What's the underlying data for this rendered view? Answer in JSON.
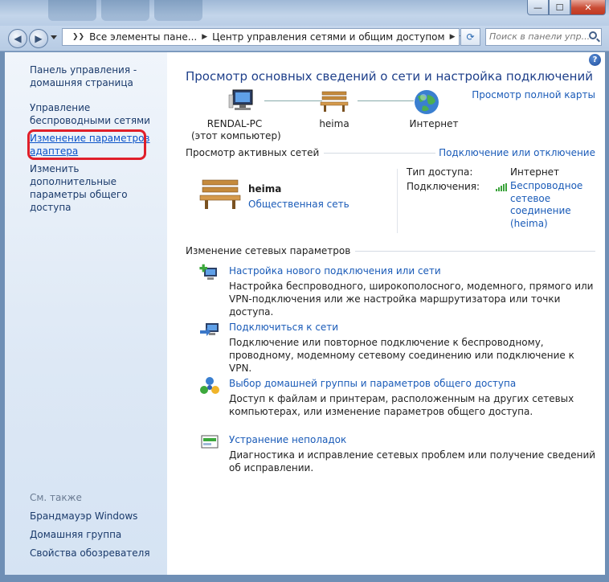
{
  "window": {
    "minimize_glyph": "—",
    "maximize_glyph": "☐",
    "close_glyph": "✕"
  },
  "address": {
    "crumbs": [
      "Все элементы пане...",
      "Центр управления сетями и общим доступом"
    ],
    "search_placeholder": "Поиск в панели упр..."
  },
  "sidebar": {
    "home": "Панель управления - домашняя страница",
    "wireless": "Управление беспроводными сетями",
    "adapter": "Изменение параметров адаптера",
    "advanced": "Изменить дополнительные параметры общего доступа",
    "see_also_title": "См. также",
    "see_also": [
      "Брандмауэр Windows",
      "Домашняя группа",
      "Свойства обозревателя"
    ]
  },
  "main": {
    "help": "?",
    "title": "Просмотр основных сведений о сети и настройка подключений",
    "full_map": "Просмотр полной карты",
    "map": {
      "computer_name": "RENDAL-PC",
      "computer_sub": "(этот компьютер)",
      "network": "heima",
      "internet": "Интернет"
    },
    "active_header": "Просмотр активных сетей",
    "connect_disconnect": "Подключение или отключение",
    "active": {
      "name": "heima",
      "type": "Общественная сеть",
      "access_label": "Тип доступа:",
      "access_value": "Интернет",
      "connections_label": "Подключения:",
      "connection_value": "Беспроводное сетевое соединение (heima)"
    },
    "change_header": "Изменение сетевых параметров",
    "tasks": [
      {
        "title": "Настройка нового подключения или сети",
        "desc": "Настройка беспроводного, широкополосного, модемного, прямого или VPN-подключения или же настройка маршрутизатора или точки доступа."
      },
      {
        "title": "Подключиться к сети",
        "desc": "Подключение или повторное подключение к беспроводному, проводному, модемному сетевому соединению или подключение к VPN."
      },
      {
        "title": "Выбор домашней группы и параметров общего доступа",
        "desc": "Доступ к файлам и принтерам, расположенным на других сетевых компьютерах, или изменение параметров общего доступа."
      },
      {
        "title": "Устранение неполадок",
        "desc": "Диагностика и исправление сетевых проблем или получение сведений об исправлении."
      }
    ]
  }
}
